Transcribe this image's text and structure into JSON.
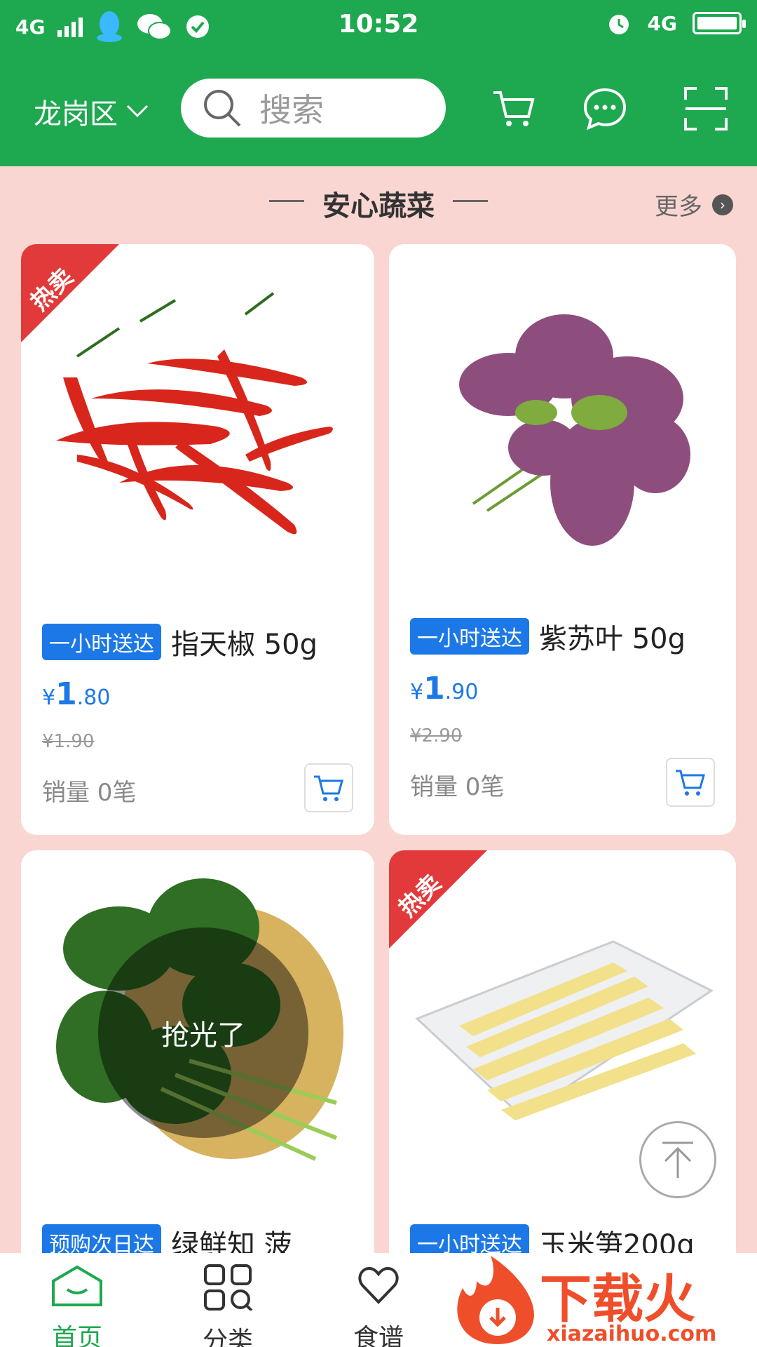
{
  "status_bar": {
    "network": "4G",
    "time": "10:52",
    "network_right": "4G"
  },
  "topbar": {
    "district": "龙岗区",
    "search_placeholder": "搜索"
  },
  "section": {
    "title": "安心蔬菜",
    "more_label": "更多"
  },
  "products": [
    {
      "hot_label": "热卖",
      "delivery_badge": "一小时送达",
      "name": "指天椒 50g",
      "price_symbol": "¥",
      "price_int": "1",
      "price_dec": ".80",
      "original_price": "¥1.90",
      "sales": "销量 0笔"
    },
    {
      "delivery_badge": "一小时送达",
      "name": "紫苏叶 50g",
      "price_symbol": "¥",
      "price_int": "1",
      "price_dec": ".90",
      "original_price": "¥2.90",
      "sales": "销量 0笔"
    },
    {
      "soldout_label": "抢光了",
      "delivery_badge": "预购次日达",
      "name": "绿鲜知 菠"
    },
    {
      "hot_label": "热卖",
      "delivery_badge": "一小时送达",
      "name": "玉米笋200g"
    }
  ],
  "bottom_nav": [
    {
      "label": "首页",
      "icon": "home-icon",
      "active": true
    },
    {
      "label": "分类",
      "icon": "category-icon",
      "active": false
    },
    {
      "label": "食谱",
      "icon": "heart-icon",
      "active": false
    }
  ],
  "watermark": {
    "text": "下载火",
    "url_text": "xiazaihuo.com"
  },
  "colors": {
    "header_green": "#1ea850",
    "background_pink": "#f9d6d2",
    "badge_blue": "#1c78e6",
    "hot_red": "#e23a3a"
  }
}
